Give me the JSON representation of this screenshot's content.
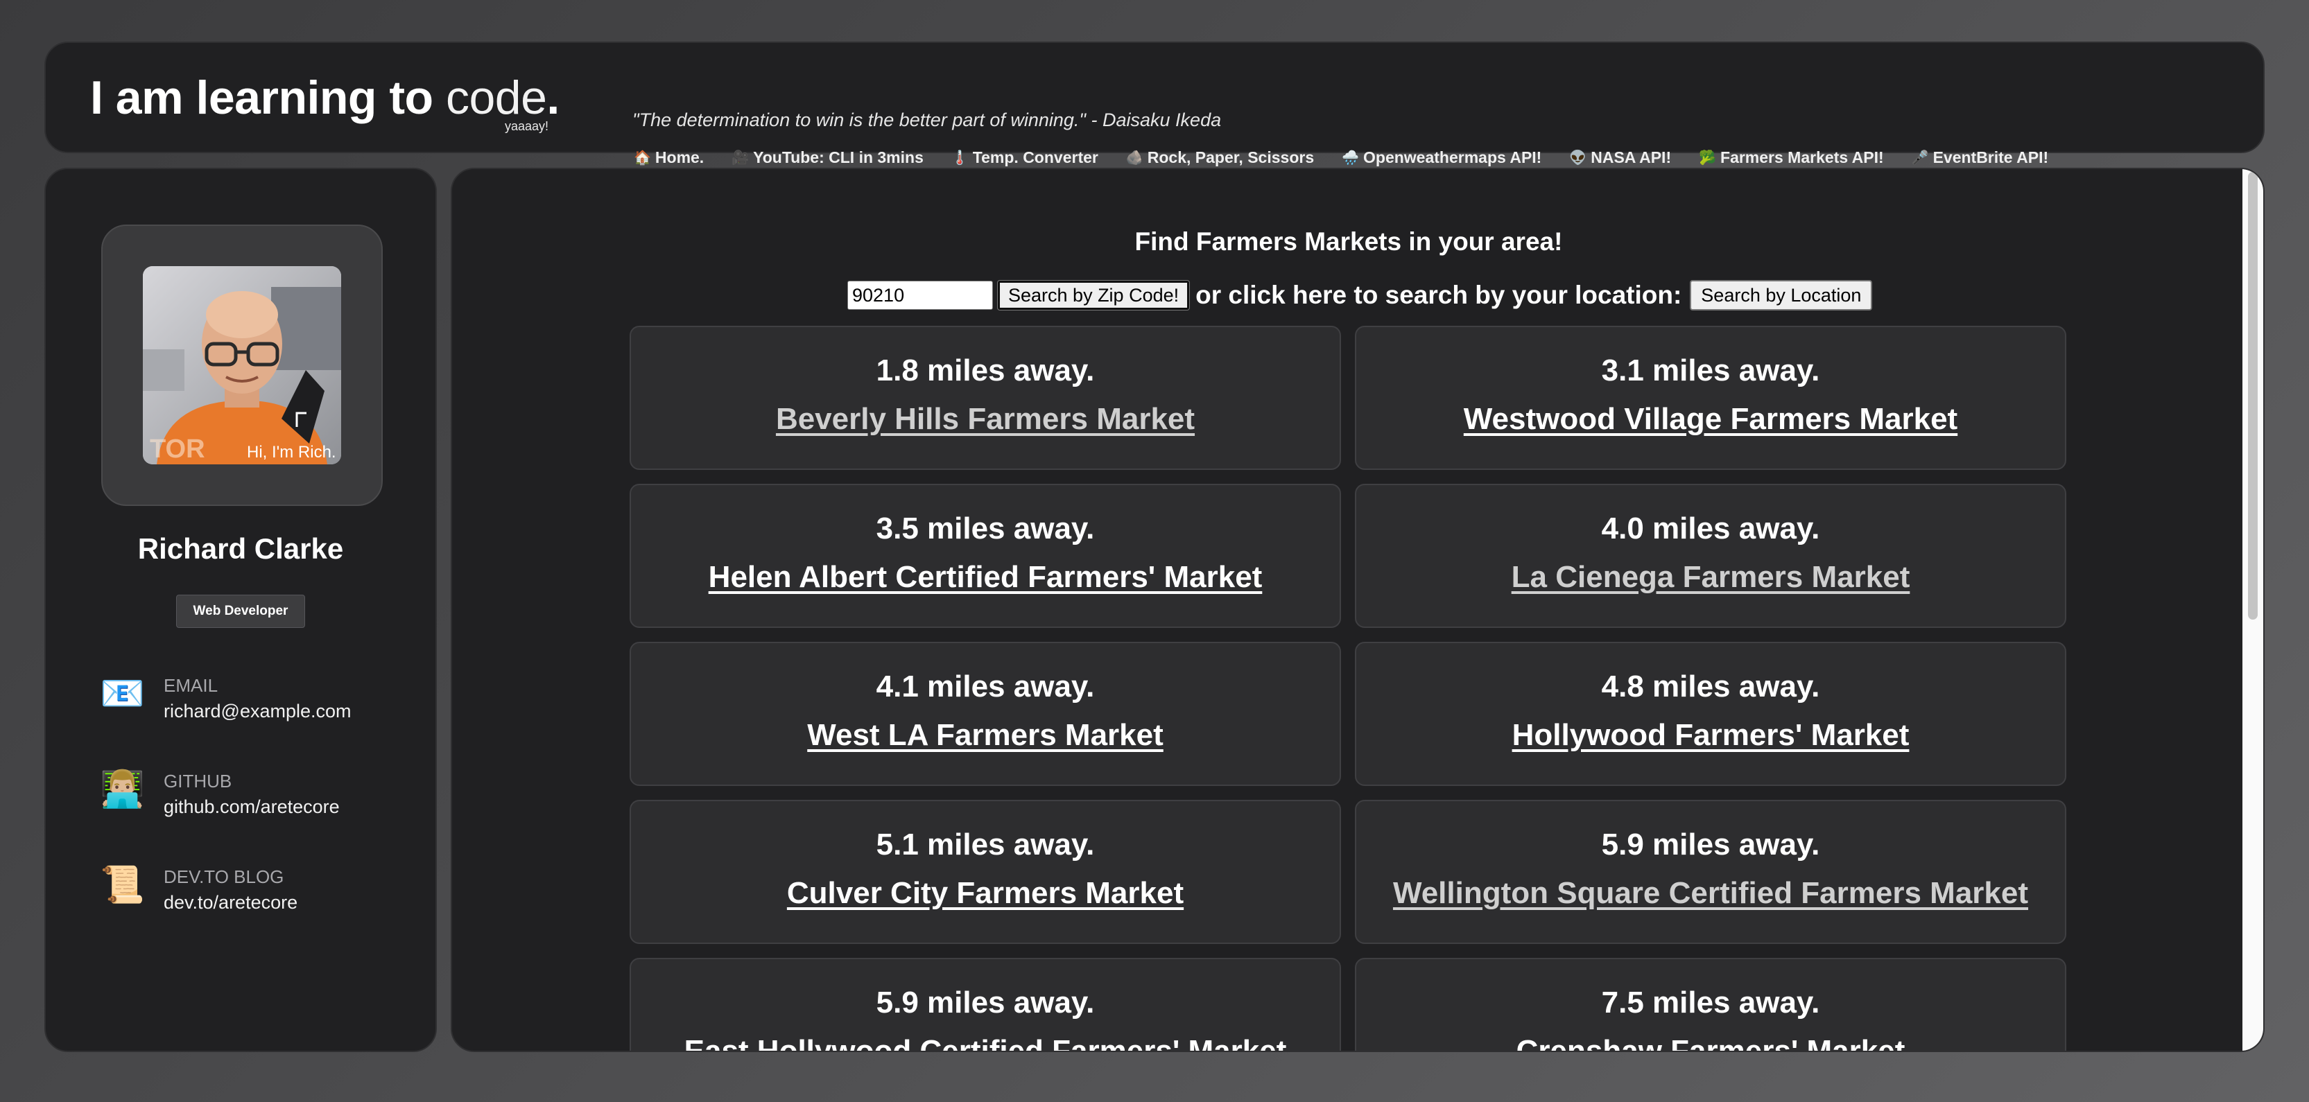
{
  "header": {
    "logo_bold": "I am learning to",
    "logo_light": "code",
    "logo_dot": ".",
    "logo_sub": "yaaaay!",
    "quote": "\"The determination to win is the better part of winning.\" - Daisaku Ikeda",
    "nav": [
      {
        "icon": "🏠",
        "icon_name": "house-icon",
        "label": "Home."
      },
      {
        "icon": "🎥",
        "icon_name": "video-camera-icon",
        "label": "YouTube: CLI in 3mins"
      },
      {
        "icon": "🌡️",
        "icon_name": "thermometer-icon",
        "label": "Temp. Converter"
      },
      {
        "icon": "🪨",
        "icon_name": "rock-icon",
        "label": "Rock, Paper, Scissors"
      },
      {
        "icon": "🌧️",
        "icon_name": "rain-cloud-icon",
        "label": "Openweathermaps API!"
      },
      {
        "icon": "👽",
        "icon_name": "alien-icon",
        "label": "NASA API!"
      },
      {
        "icon": "🥦",
        "icon_name": "broccoli-icon",
        "label": "Farmers Markets API!"
      },
      {
        "icon": "🎤",
        "icon_name": "microphone-icon",
        "label": "EventBrite API!"
      }
    ]
  },
  "sidebar": {
    "avatar_caption": "Hi, I'm Rich.",
    "name": "Richard Clarke",
    "role": "Web Developer",
    "contacts": [
      {
        "icon": "📧",
        "icon_name": "email-icon",
        "label": "EMAIL",
        "value": "richard@example.com"
      },
      {
        "icon": "👨🏼‍💻",
        "icon_name": "developer-icon",
        "label": "GITHUB",
        "value": "github.com/aretecore"
      },
      {
        "icon": "📜",
        "icon_name": "scroll-icon",
        "label": "DEV.TO BLOG",
        "value": "dev.to/aretecore"
      }
    ]
  },
  "main": {
    "title": "Find Farmers Markets in your area!",
    "zip_value": "90210",
    "search_zip_label": "Search by Zip Code!",
    "or_text": "or click here to search by your location:",
    "search_location_label": "Search by Location",
    "markets": [
      {
        "distance": "1.8 miles away.",
        "name": "Beverly Hills Farmers Market",
        "visited": true
      },
      {
        "distance": "3.1 miles away.",
        "name": "Westwood Village Farmers Market",
        "visited": false
      },
      {
        "distance": "3.5 miles away.",
        "name": "Helen Albert Certified Farmers' Market",
        "visited": false
      },
      {
        "distance": "4.0 miles away.",
        "name": "La Cienega Farmers Market",
        "visited": true
      },
      {
        "distance": "4.1 miles away.",
        "name": "West LA Farmers Market",
        "visited": false
      },
      {
        "distance": "4.8 miles away.",
        "name": "Hollywood Farmers' Market",
        "visited": false
      },
      {
        "distance": "5.1 miles away.",
        "name": "Culver City Farmers Market",
        "visited": false
      },
      {
        "distance": "5.9 miles away.",
        "name": "Wellington Square Certified Farmers Market",
        "visited": true
      },
      {
        "distance": "5.9 miles away.",
        "name": "East Hollywood Certified Farmers' Market",
        "visited": false
      },
      {
        "distance": "7.5 miles away.",
        "name": "Crenshaw Farmers' Market",
        "visited": false
      }
    ]
  }
}
